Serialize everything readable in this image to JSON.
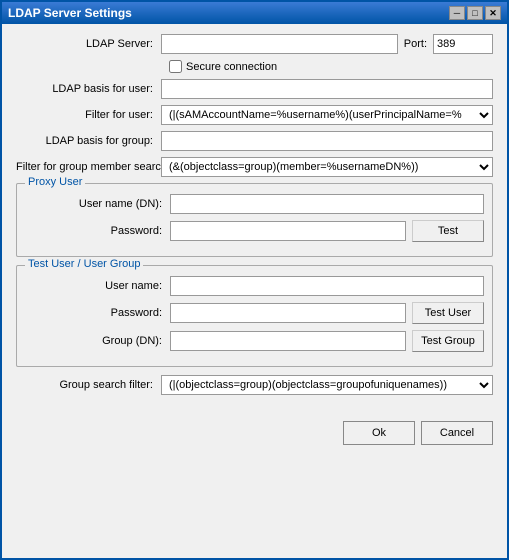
{
  "window": {
    "title": "LDAP Server Settings",
    "close_btn": "✕",
    "min_btn": "─",
    "max_btn": "□"
  },
  "form": {
    "ldap_server_label": "LDAP Server:",
    "ldap_server_value": "",
    "port_label": "Port:",
    "port_value": "389",
    "secure_label": "Secure connection",
    "ldap_basis_user_label": "LDAP basis for user:",
    "ldap_basis_user_value": "",
    "filter_user_label": "Filter for user:",
    "filter_user_value": "(|(sAMAccountName=%username%)(userPrincipalName=%",
    "filter_user_options": [
      "(|(sAMAccountName=%username%)(userPrincipalName=%"
    ],
    "ldap_basis_group_label": "LDAP basis for group:",
    "ldap_basis_group_value": "",
    "filter_group_label": "Filter for group member search:",
    "filter_group_value": "(&(objectclass=group)(member=%usernameDN%))",
    "filter_group_options": [
      "(&(objectclass=group)(member=%usernameDN%))"
    ]
  },
  "proxy_user": {
    "section_title": "Proxy User",
    "username_label": "User name (DN):",
    "username_value": "",
    "password_label": "Password:",
    "password_value": "",
    "test_btn": "Test"
  },
  "test_user_group": {
    "section_title": "Test User / User Group",
    "username_label": "User name:",
    "username_value": "",
    "password_label": "Password:",
    "password_value": "",
    "test_user_btn": "Test User",
    "group_label": "Group (DN):",
    "group_value": "",
    "test_group_btn": "Test Group"
  },
  "group_search": {
    "label": "Group search filter:",
    "value": "(|(objectclass=group)(objectclass=groupofuniquenames))",
    "options": [
      "(|(objectclass=group)(objectclass=groupofuniquenames))"
    ]
  },
  "footer": {
    "ok_btn": "Ok",
    "cancel_btn": "Cancel"
  }
}
